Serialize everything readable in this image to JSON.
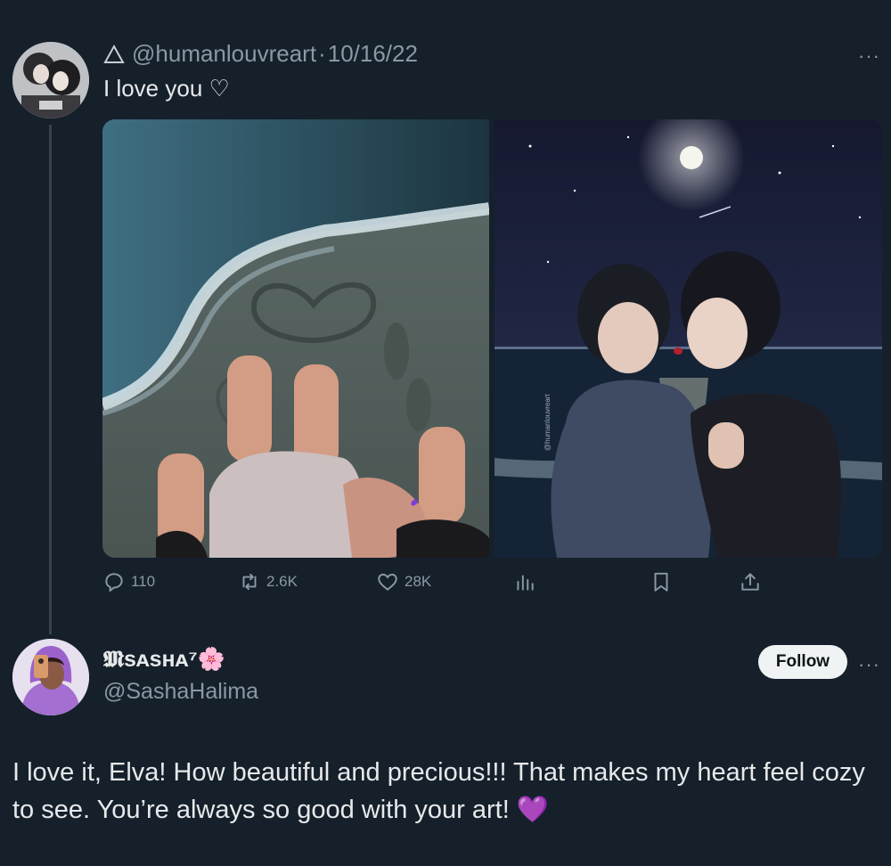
{
  "tweet": {
    "badge_icon": "triangle-outline-icon",
    "handle": "@humanlouvreart",
    "separator": "·",
    "date": "10/16/22",
    "text": "I love you ♡",
    "more": "···",
    "media": [
      {
        "label": "image-beach-footprints-heart"
      },
      {
        "label": "image-moonlit-kiss",
        "watermark": "@humanlouvreart"
      }
    ],
    "actions": {
      "replies": "110",
      "retweets": "2.6K",
      "likes": "28K"
    }
  },
  "reply": {
    "display_name": "𝕸sᴀsʜᴀ⁷🌸",
    "handle": "@SashaHalima",
    "follow_label": "Follow",
    "more": "···",
    "text": "I love it, Elva! How beautiful and precious!!! That makes my heart feel cozy to see. You’re always so good with your art! 💜"
  },
  "colors": {
    "background": "#15202b",
    "text_primary": "#e7e9ea",
    "text_secondary": "#8b98a5",
    "follow_bg": "#eff3f4"
  }
}
